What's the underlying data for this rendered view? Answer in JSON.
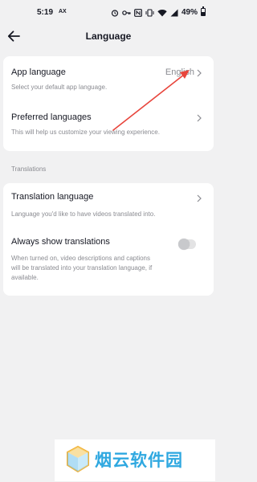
{
  "status_bar": {
    "time": "5:19",
    "carrier": "AX",
    "battery_text": "49%",
    "battery_level": 0.49,
    "icons": [
      "alarm-icon",
      "key-icon",
      "nfc-icon",
      "vibrate-icon",
      "wifi-icon",
      "signal-icon",
      "battery-icon"
    ]
  },
  "nav": {
    "title": "Language",
    "back_icon": "arrow-left-icon"
  },
  "card1": {
    "app_language": {
      "title": "App language",
      "value": "English",
      "subtitle": "Select your default app language."
    },
    "preferred_languages": {
      "title": "Preferred languages",
      "subtitle": "This will help us customize your viewing experience."
    }
  },
  "translations": {
    "section_label": "Translations",
    "translation_language": {
      "title": "Translation language",
      "subtitle": "Language you'd like to have videos translated into."
    },
    "always_show": {
      "title": "Always show translations",
      "subtitle_line1": "When turned on, video descriptions and captions",
      "subtitle_line2": "will be translated into your translation language, if",
      "subtitle_line3": "available.",
      "toggle_on": false
    }
  },
  "colors": {
    "background": "#f1f1f2",
    "card": "#ffffff",
    "primary_text": "#161823",
    "secondary_text": "#8a8b91",
    "annotation_arrow": "#e8453c",
    "watermark_blue": "#2fa8e0"
  },
  "watermark": {
    "text": "烟云软件园"
  }
}
